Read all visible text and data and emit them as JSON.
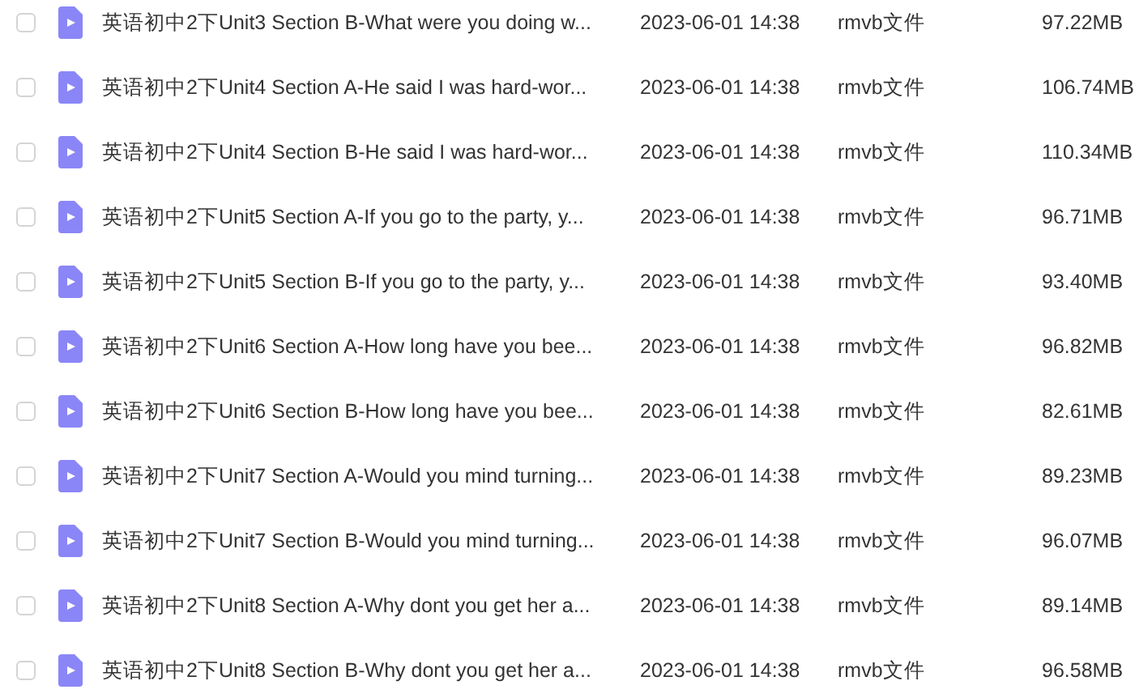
{
  "files": [
    {
      "checked": false,
      "name": "英语初中2下Unit3 Section B-What were you doing w...",
      "date": "2023-06-01 14:38",
      "type": "rmvb文件",
      "size": "97.22MB"
    },
    {
      "checked": false,
      "name": "英语初中2下Unit4 Section A-He said I was hard-wor...",
      "date": "2023-06-01 14:38",
      "type": "rmvb文件",
      "size": "106.74MB"
    },
    {
      "checked": false,
      "name": "英语初中2下Unit4 Section B-He said I was hard-wor...",
      "date": "2023-06-01 14:38",
      "type": "rmvb文件",
      "size": "110.34MB"
    },
    {
      "checked": false,
      "name": "英语初中2下Unit5 Section A-If you go to the party, y...",
      "date": "2023-06-01 14:38",
      "type": "rmvb文件",
      "size": "96.71MB"
    },
    {
      "checked": false,
      "name": "英语初中2下Unit5 Section B-If you go to the party, y...",
      "date": "2023-06-01 14:38",
      "type": "rmvb文件",
      "size": "93.40MB"
    },
    {
      "checked": false,
      "name": "英语初中2下Unit6 Section A-How long have you bee...",
      "date": "2023-06-01 14:38",
      "type": "rmvb文件",
      "size": "96.82MB"
    },
    {
      "checked": false,
      "name": "英语初中2下Unit6 Section B-How long have you bee...",
      "date": "2023-06-01 14:38",
      "type": "rmvb文件",
      "size": "82.61MB"
    },
    {
      "checked": false,
      "name": "英语初中2下Unit7 Section A-Would you mind turning...",
      "date": "2023-06-01 14:38",
      "type": "rmvb文件",
      "size": "89.23MB"
    },
    {
      "checked": false,
      "name": "英语初中2下Unit7 Section B-Would you mind turning...",
      "date": "2023-06-01 14:38",
      "type": "rmvb文件",
      "size": "96.07MB"
    },
    {
      "checked": false,
      "name": "英语初中2下Unit8 Section A-Why dont you get her a...",
      "date": "2023-06-01 14:38",
      "type": "rmvb文件",
      "size": "89.14MB"
    },
    {
      "checked": false,
      "name": "英语初中2下Unit8 Section B-Why dont you get her a...",
      "date": "2023-06-01 14:38",
      "type": "rmvb文件",
      "size": "96.58MB"
    }
  ]
}
